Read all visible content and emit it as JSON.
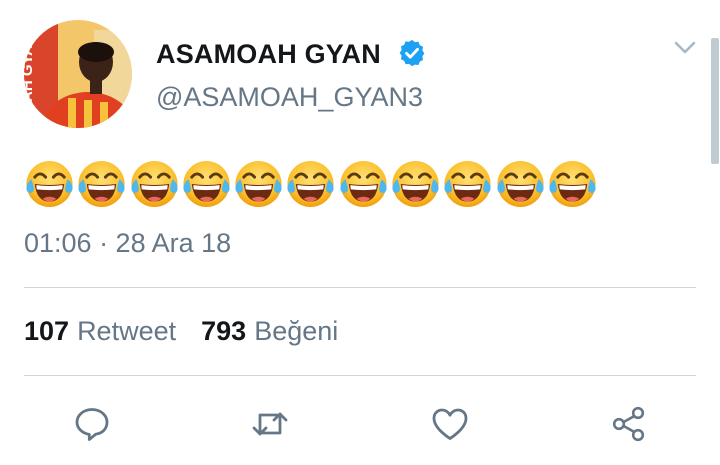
{
  "tweet": {
    "author": {
      "display_name": "ASAMOAH GYAN",
      "handle": "@ASAMOAH_GYAN3",
      "avatar_text": "AH GYAN",
      "verified_icon": "verified-badge-icon"
    },
    "emoji": {
      "name": "face-with-tears-of-joy",
      "count": 11
    },
    "timestamp": "01:06 · 28 Ara 18",
    "stats": {
      "retweets_count": "107",
      "retweets_label": "Retweet",
      "likes_count": "793",
      "likes_label": "Beğeni"
    },
    "actions": [
      "reply-icon",
      "retweet-icon",
      "like-icon",
      "share-icon"
    ],
    "menu_icon": "chevron-down-icon"
  },
  "colors": {
    "text_primary": "#14171a",
    "text_secondary": "#657786",
    "accent": "#1da1f2",
    "divider": "#ccd6dd"
  }
}
